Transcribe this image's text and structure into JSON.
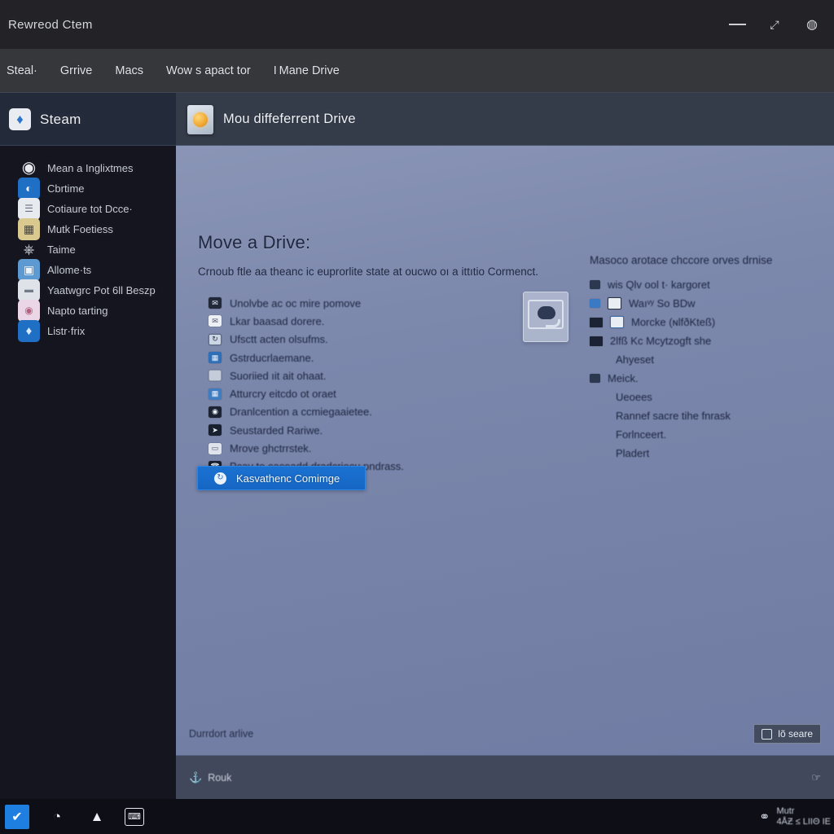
{
  "window": {
    "title": "Rewreod Ctem",
    "controls": [
      {
        "name": "minimize-button",
        "glyph": "—"
      },
      {
        "name": "restore-button",
        "glyph": "⤢"
      },
      {
        "name": "close-button",
        "glyph": "◍"
      }
    ]
  },
  "tabs": [
    {
      "label": "Steal·"
    },
    {
      "label": "Grrive"
    },
    {
      "label": "Macs"
    },
    {
      "label": "Wow s apact tor"
    },
    {
      "label": "I Mane Drive"
    }
  ],
  "sidebar": {
    "header": {
      "label": "Steam",
      "icon": "steam-icon"
    },
    "items": [
      {
        "label": "Mean a Inglixtmes",
        "icon": "ring-icon",
        "style": "ring"
      },
      {
        "label": "Cbrtime",
        "icon": "clock-icon",
        "style": "blue"
      },
      {
        "label": "Cotiaure tot Dcce·",
        "icon": "document-icon",
        "style": "paper"
      },
      {
        "label": "Mutk Foetiess",
        "icon": "folder-multi-icon",
        "style": "multi"
      },
      {
        "label": "Taime",
        "icon": "flag-icon",
        "style": "flat"
      },
      {
        "label": "Allome·ts",
        "icon": "image-icon",
        "style": "cyan"
      },
      {
        "label": "Yaatwgrc Pot 6ll Beszp",
        "icon": "note-icon",
        "style": "pale"
      },
      {
        "label": "Napto tarting",
        "icon": "photo-icon",
        "style": "pink"
      },
      {
        "label": "Listr·frix",
        "icon": "gem-icon",
        "style": "gem"
      }
    ]
  },
  "content": {
    "header": {
      "title": "Mou diffeferrent Drive",
      "icon": "drive-document-icon"
    },
    "heading": "Move a Drive:",
    "subtitle": "Crnoub ftle aa theanc ic euprorlite state at oucwo oı a ittıtio Cormenct.",
    "bullets": [
      {
        "label": "Unolvbe ac oc mire pomove",
        "icon": "mail-icon",
        "style": "dark"
      },
      {
        "label": "Lkar baasad dorere.",
        "icon": "envelope-icon",
        "style": "white",
        "glyph": "✉"
      },
      {
        "label": "Ufsctt acten olsufms.",
        "icon": "refresh-icon",
        "style": "outl",
        "glyph": "↻"
      },
      {
        "label": "Gstrducrlaemane.",
        "icon": "grid-icon",
        "style": "blue",
        "glyph": "▦"
      },
      {
        "label": "Suoriied ıit ait ohaat.",
        "icon": "blank-icon",
        "style": "pale"
      },
      {
        "label": "Atturcry eitcdo ot oraet",
        "icon": "table-icon",
        "style": "grid",
        "glyph": "▦"
      },
      {
        "label": "Dranlcention a ccmiegaaietee.",
        "icon": "camera-icon",
        "style": "cam",
        "glyph": "◉"
      },
      {
        "label": "Seustarded Rariwe.",
        "icon": "arrow-icon",
        "style": "arrow",
        "glyph": "➤"
      },
      {
        "label": "Mrove ghctrrstek.",
        "icon": "monitor-icon",
        "style": "screen",
        "glyph": "▭"
      },
      {
        "label": "Pcav to caceadd dradcriecu pndrass.",
        "icon": "phone-icon",
        "style": "phone",
        "glyph": "☎"
      }
    ],
    "primary_button": {
      "label": "Kasvathenc Comimge",
      "icon": "refresh-circle-icon"
    },
    "right_column": {
      "title": "Masoco arotace chccore orves drnise",
      "rows": [
        {
          "label": "wis Qlv ool t· kargoret",
          "icon": "square-icon",
          "style": "plain",
          "indent": 0
        },
        {
          "label": "Waıᵛʸ  So BDw",
          "icon": "document-icon",
          "style": "doc",
          "indent": 1
        },
        {
          "label": "Morcke (ɴlfðKteß)",
          "icon": "document-blue-icon",
          "style": "doc2",
          "indent": 1
        },
        {
          "label": "2lfß Kc Mcytzogft she",
          "icon": "pen-icon",
          "style": "pen",
          "indent": 0
        },
        {
          "label": "Ahyeset",
          "icon": "none",
          "style": "none",
          "indent": 2
        },
        {
          "label": "Meick.",
          "icon": "square-icon",
          "style": "plain",
          "indent": 0
        },
        {
          "label": "Ueoees",
          "icon": "none",
          "style": "none",
          "indent": 2
        },
        {
          "label": "Rannef sacre tihe fnrask",
          "icon": "none",
          "style": "none",
          "indent": 2
        },
        {
          "label": "Forlnceert.",
          "icon": "none",
          "style": "none",
          "indent": 2
        },
        {
          "label": "Pladert",
          "icon": "none",
          "style": "none",
          "indent": 2
        }
      ]
    },
    "status": {
      "text": "Durrdort arlive",
      "share_button": {
        "label": "lõ seare",
        "icon": "share-icon"
      }
    },
    "footer": {
      "icon": "anchor-icon",
      "text": "Rouk",
      "right_icon": "cursor-icon"
    }
  },
  "taskbar": {
    "items": [
      {
        "name": "check-icon",
        "glyph": "✔",
        "style": "checked"
      },
      {
        "name": "browser-icon",
        "glyph": "◔",
        "style": "plain"
      },
      {
        "name": "cloud-icon",
        "glyph": "▲",
        "style": "plain"
      },
      {
        "name": "terminal-icon",
        "glyph": "⌨",
        "style": "boxed"
      }
    ],
    "tray": {
      "icon": "network-icon",
      "label_top": "Mutr",
      "label_bottom": "4ÅƵ   ≤   LΙΙΘ ΙΕ"
    }
  },
  "colors": {
    "titlebar": "#232327",
    "tabstrip": "#35373b",
    "sidebar": "#15151f",
    "sidebar_header": "#232a3a",
    "content_header": "#343b49",
    "content_bg": "#7b87ab",
    "accent_blue": "#1b72d1",
    "footer": "#41485b",
    "taskbar": "#0d0e16"
  }
}
